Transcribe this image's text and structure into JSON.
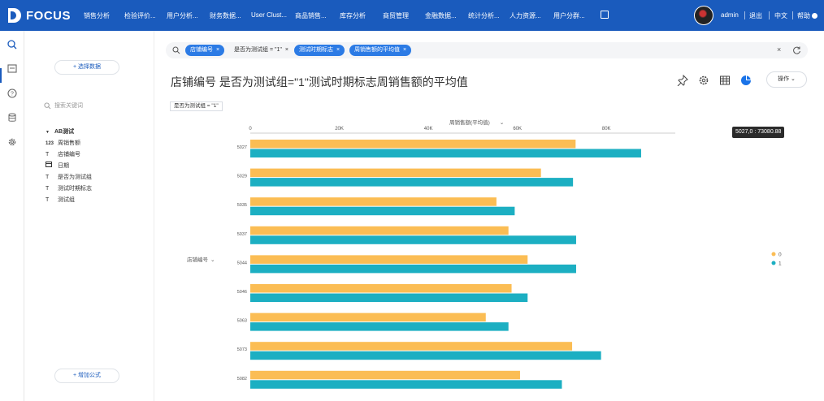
{
  "app": {
    "logo_text": "FOCUS",
    "brand_color": "#1a5bbd",
    "nav": [
      "销售分析",
      "检验评价...",
      "用户分析...",
      "财务数据...",
      "User Clust...",
      "商品销售...",
      "库存分析",
      "商贸管理",
      "金融数据...",
      "统计分析...",
      "人力资源...",
      "用户分群..."
    ],
    "user": "admin",
    "logout": "退出",
    "lang": "中文",
    "help": "帮助"
  },
  "sidebar": {
    "select_data_label": "+ 选择数据",
    "search_placeholder": "搜索关键词",
    "group_label": "AB测试",
    "fields": [
      {
        "icon": "123",
        "label": "周销售额"
      },
      {
        "icon": "T",
        "label": "店铺编号"
      },
      {
        "icon": "cal",
        "label": "日期"
      },
      {
        "icon": "T",
        "label": "是否为测试组"
      },
      {
        "icon": "T",
        "label": "测试时期标志"
      },
      {
        "icon": "T",
        "label": "测试组"
      }
    ],
    "add_formula_label": "+ 增加公式"
  },
  "search_bar": {
    "chips": [
      {
        "label": "店铺编号",
        "style": "blue"
      },
      {
        "label": "是否为测试组 = \"1\"",
        "style": "plain"
      },
      {
        "label": "测试时期标志",
        "style": "blue"
      },
      {
        "label": "周销售额的平均值",
        "style": "blue"
      }
    ]
  },
  "page": {
    "title": "店铺编号 是否为测试组=\"1\"测试时期标志周销售额的平均值",
    "sub_filter": "是否为测试组 = \"1\"",
    "ops_label": "操作",
    "tooltip": "5027,0 : 73080.88"
  },
  "chart_data": {
    "type": "bar",
    "orientation": "horizontal",
    "x_axis_title": "周销售额(平均值)",
    "y_axis_title": "店铺编号",
    "x_ticks": [
      "0",
      "20K",
      "40K",
      "60K",
      "80K"
    ],
    "xlim": [
      0,
      90000
    ],
    "categories": [
      "5027",
      "5029",
      "5035",
      "5037",
      "5044",
      "5046",
      "5063",
      "5073",
      "5082"
    ],
    "series": [
      {
        "name": "0",
        "color": "#fbbd54",
        "values": [
          73080.88,
          65300,
          55300,
          58000,
          62300,
          58700,
          52900,
          72300,
          60600
        ]
      },
      {
        "name": "1",
        "color": "#1cafc2",
        "values": [
          87800,
          72500,
          59400,
          73200,
          73200,
          62300,
          58000,
          78800,
          70000
        ]
      }
    ],
    "legend_position": "right",
    "grid": false
  }
}
